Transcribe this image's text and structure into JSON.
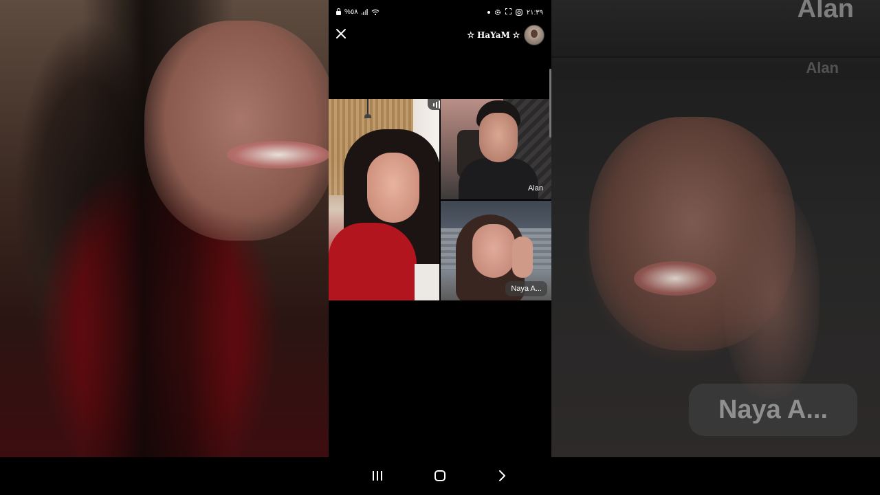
{
  "status_bar": {
    "battery": "%٥٨",
    "time": "٢١:٣٩"
  },
  "header": {
    "host_name": "✫ HaYaM ✫"
  },
  "participants": [
    {
      "name": "Alan"
    },
    {
      "name": "Naya A..."
    }
  ],
  "blurred_background": {
    "top_label": "Alan",
    "mid_label": "Alan",
    "pill_label": "Naya A..."
  },
  "icons": {
    "status": [
      "lock-icon",
      "signal-icon",
      "wifi-icon",
      "dot-icon",
      "gear-icon",
      "screen-record-icon",
      "instagram-icon"
    ],
    "nav": [
      "recents-icon",
      "home-icon",
      "back-icon"
    ],
    "close": "close-icon",
    "audio": "audio-wave-icon"
  }
}
